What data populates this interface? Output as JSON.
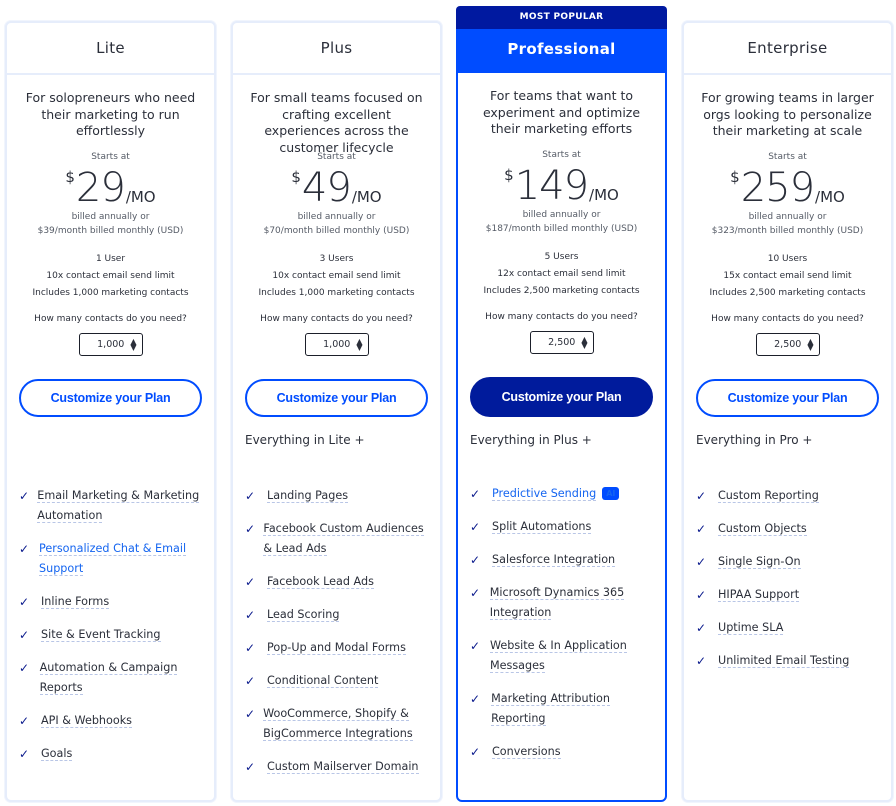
{
  "plans": [
    {
      "name": "Lite",
      "description": "For solopreneurs who need their marketing to run effortlessly",
      "starts_at": "Starts at",
      "currency": "$",
      "price": "29",
      "period": "/MO",
      "billed_line1": "billed annually or",
      "billed_line2": "$39/month billed monthly (USD)",
      "includes": [
        "1 User",
        "10x contact email send limit",
        "Includes 1,000 marketing contacts"
      ],
      "contacts_question": "How many contacts do you need?",
      "contacts_value": "1,000",
      "cta": "Customize your Plan",
      "everything_in": "",
      "features": [
        {
          "label": "Email Marketing & Marketing Automation",
          "highlight": false
        },
        {
          "label": "Personalized Chat & Email Support",
          "highlight": true
        },
        {
          "label": "Inline Forms",
          "highlight": false
        },
        {
          "label": "Site & Event Tracking",
          "highlight": false
        },
        {
          "label": "Automation & Campaign Reports",
          "highlight": false
        },
        {
          "label": "API & Webhooks",
          "highlight": false
        },
        {
          "label": "Goals",
          "highlight": false
        }
      ]
    },
    {
      "name": "Plus",
      "description": "For small teams focused on crafting excellent experiences across the customer lifecycle",
      "starts_at": "Starts at",
      "currency": "$",
      "price": "49",
      "period": "/MO",
      "billed_line1": "billed annually or",
      "billed_line2": "$70/month billed monthly (USD)",
      "includes": [
        "3 Users",
        "10x contact email send limit",
        "Includes 1,000 marketing contacts"
      ],
      "contacts_question": "How many contacts do you need?",
      "contacts_value": "1,000",
      "cta": "Customize your Plan",
      "everything_in": "Everything in Lite +",
      "features": [
        {
          "label": "Landing Pages",
          "highlight": false
        },
        {
          "label": "Facebook Custom Audiences & Lead Ads",
          "highlight": false
        },
        {
          "label": "Facebook Lead Ads",
          "highlight": false
        },
        {
          "label": "Lead Scoring",
          "highlight": false
        },
        {
          "label": "Pop-Up and Modal Forms",
          "highlight": false
        },
        {
          "label": "Conditional Content",
          "highlight": false
        },
        {
          "label": "WooCommerce, Shopify & BigCommerce Integrations",
          "highlight": false
        },
        {
          "label": "Custom Mailserver Domain",
          "highlight": false
        }
      ]
    },
    {
      "badge": "MOST POPULAR",
      "name": "Professional",
      "description": "For teams that want to experiment and optimize their marketing efforts",
      "starts_at": "Starts at",
      "currency": "$",
      "price": "149",
      "period": "/MO",
      "billed_line1": "billed annually or",
      "billed_line2": "$187/month billed monthly (USD)",
      "includes": [
        "5 Users",
        "12x contact email send limit",
        "Includes 2,500 marketing contacts"
      ],
      "contacts_question": "How many contacts do you need?",
      "contacts_value": "2,500",
      "cta": "Customize your Plan",
      "everything_in": "Everything in Plus +",
      "features": [
        {
          "label": "Predictive Sending",
          "highlight": true,
          "tag": "AI"
        },
        {
          "label": "Split Automations",
          "highlight": false
        },
        {
          "label": "Salesforce Integration",
          "highlight": false
        },
        {
          "label": "Microsoft Dynamics 365 Integration",
          "highlight": false
        },
        {
          "label": "Website & In Application Messages",
          "highlight": false
        },
        {
          "label": "Marketing Attribution Reporting",
          "highlight": false
        },
        {
          "label": "Conversions",
          "highlight": false
        }
      ]
    },
    {
      "name": "Enterprise",
      "description": "For growing teams in larger orgs looking to personalize their marketing at scale",
      "starts_at": "Starts at",
      "currency": "$",
      "price": "259",
      "period": "/MO",
      "billed_line1": "billed annually or",
      "billed_line2": "$323/month billed monthly (USD)",
      "includes": [
        "10 Users",
        "15x contact email send limit",
        "Includes 2,500 marketing contacts"
      ],
      "contacts_question": "How many contacts do you need?",
      "contacts_value": "2,500",
      "cta": "Customize your Plan",
      "everything_in": "Everything in Pro +",
      "features": [
        {
          "label": "Custom Reporting",
          "highlight": false
        },
        {
          "label": "Custom Objects",
          "highlight": false
        },
        {
          "label": "Single Sign-On",
          "highlight": false
        },
        {
          "label": "HIPAA Support",
          "highlight": false
        },
        {
          "label": "Uptime SLA",
          "highlight": false
        },
        {
          "label": "Unlimited Email Testing",
          "highlight": false
        }
      ]
    }
  ],
  "icons": {
    "check": "✓",
    "stepper_up": "▲",
    "stepper_down": "▼"
  },
  "colors": {
    "brand_blue": "#004cff",
    "navy": "#001b9c",
    "badge_navy": "#0019a0",
    "link_blue": "#1565f0"
  }
}
